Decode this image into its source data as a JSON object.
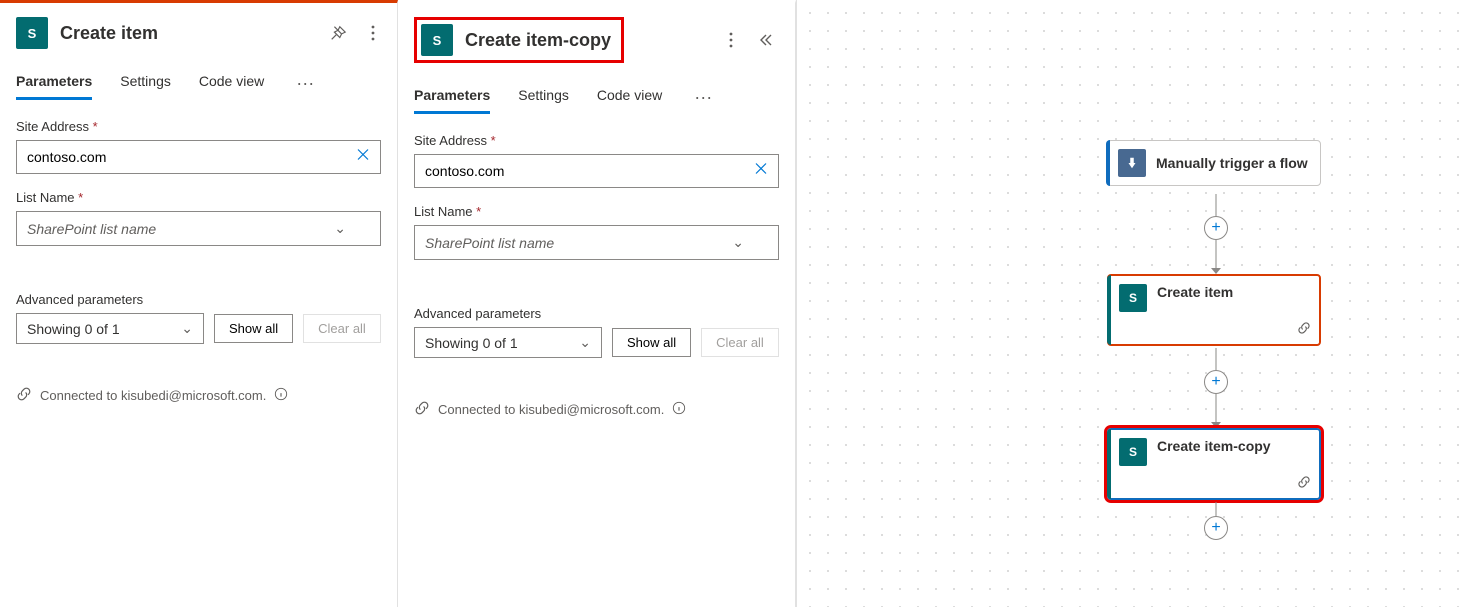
{
  "panels": {
    "left": {
      "title": "Create item",
      "icon_label": "S",
      "tabs": {
        "parameters": "Parameters",
        "settings": "Settings",
        "code": "Code view"
      },
      "site_label": "Site Address",
      "site_value": "contoso.com",
      "list_label": "List Name",
      "list_placeholder": "SharePoint list name",
      "adv_label": "Advanced parameters",
      "adv_showing": "Showing 0 of 1",
      "show_all": "Show all",
      "clear_all": "Clear all",
      "connected": "Connected to kisubedi@microsoft.com."
    },
    "right": {
      "title": "Create item-copy",
      "icon_label": "S",
      "tabs": {
        "parameters": "Parameters",
        "settings": "Settings",
        "code": "Code view"
      },
      "site_label": "Site Address",
      "site_value": "contoso.com",
      "list_label": "List Name",
      "list_placeholder": "SharePoint list name",
      "adv_label": "Advanced parameters",
      "adv_showing": "Showing 0 of 1",
      "show_all": "Show all",
      "clear_all": "Clear all",
      "connected": "Connected to kisubedi@microsoft.com."
    }
  },
  "canvas": {
    "node1": "Manually trigger a flow",
    "node2": "Create item",
    "node3": "Create item-copy"
  }
}
